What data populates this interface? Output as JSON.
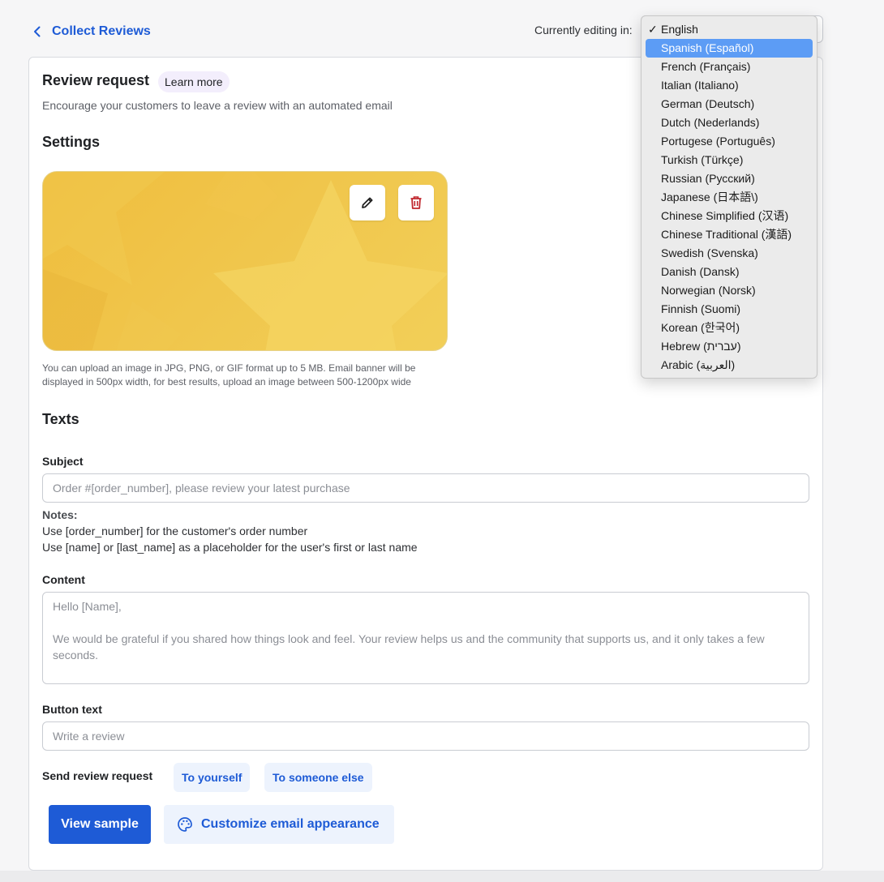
{
  "header": {
    "back_label": "Collect Reviews",
    "editing_label": "Currently editing in:"
  },
  "review_request": {
    "title": "Review request",
    "learn_more": "Learn more",
    "description": "Encourage your customers to leave a review with an automated email"
  },
  "settings": {
    "heading": "Settings",
    "help_text": "You can upload an image in JPG, PNG, or GIF format up to 5 MB. Email banner will be displayed in 500px width, for best results, upload an image between 500-1200px wide"
  },
  "texts": {
    "heading": "Texts",
    "subject_label": "Subject",
    "subject_placeholder": "Order #[order_number], please review your latest purchase",
    "notes_title": "Notes:",
    "notes_line1": "Use [order_number] for the customer's order number",
    "notes_line2": "Use [name] or [last_name] as a placeholder for the user's first or last name",
    "content_label": "Content",
    "content_placeholder": "Hello [Name],\n\nWe would be grateful if you shared how things look and feel. Your review helps us and the community that supports us, and it only takes a few seconds.",
    "button_text_label": "Button text",
    "button_text_placeholder": "Write a review"
  },
  "send": {
    "label": "Send review request",
    "to_yourself": "To yourself",
    "to_someone_else": "To someone else"
  },
  "actions": {
    "view_sample": "View sample",
    "customize": "Customize email appearance"
  },
  "language_dropdown": {
    "checked_value": "English",
    "highlighted_value": "Spanish (Español)",
    "items": [
      "English",
      "Spanish (Español)",
      "French (Français)",
      "Italian (Italiano)",
      "German (Deutsch)",
      "Dutch (Nederlands)",
      "Portugese (Português)",
      "Turkish (Türkçe)",
      "Russian (Русский)",
      "Japanese (日本語\\)",
      "Chinese Simplified (汉语)",
      "Chinese Traditional (漢語)",
      "Swedish (Svenska)",
      "Danish (Dansk)",
      "Norwegian (Norsk)",
      "Finnish (Suomi)",
      "Korean (한국어)",
      "Hebrew (עברית)",
      "Arabic (العربية)"
    ]
  },
  "colors": {
    "accent": "#1e5bd6",
    "delete_icon": "#c0262d",
    "banner": "#f0c64c"
  }
}
